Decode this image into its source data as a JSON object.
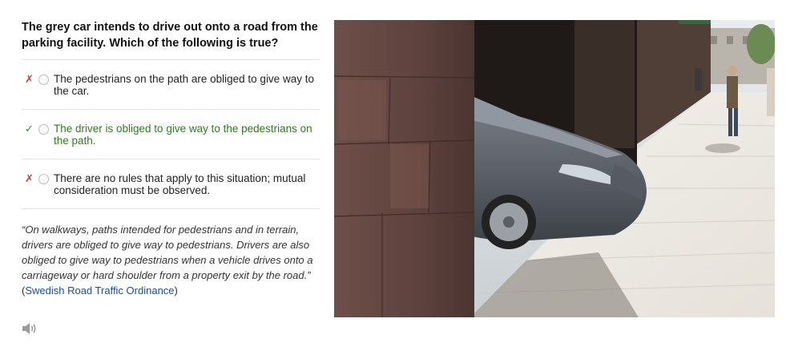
{
  "question": "The grey car intends to drive out onto a road from the parking facility. Which of the following is true?",
  "options": [
    {
      "text": "The pedestrians on the path are obliged to give way to the car.",
      "status": "wrong",
      "mark": "✗"
    },
    {
      "text": "The driver is obliged to give way to the pedestrians on the path.",
      "status": "correct",
      "mark": "✓"
    },
    {
      "text": "There are no rules that apply to this situation; mutual consideration must be observed.",
      "status": "wrong",
      "mark": "✗"
    }
  ],
  "explanation": {
    "quote": "“On walkways, paths intended for pedestrians and in terrain, drivers are obliged to give way to pedestrians. Drivers are also obliged to give way to pedestrians when a vehicle drives onto a carriageway or hard shoulder from a property exit by the road.”",
    "open_paren": " (",
    "source": "Swedish Road Traffic Ordinance",
    "close_paren": ")"
  },
  "icons": {
    "speaker": "speaker-icon"
  },
  "colors": {
    "correct": "#2e7d1f",
    "wrong": "#dd3333",
    "link": "#1a4f9c"
  }
}
